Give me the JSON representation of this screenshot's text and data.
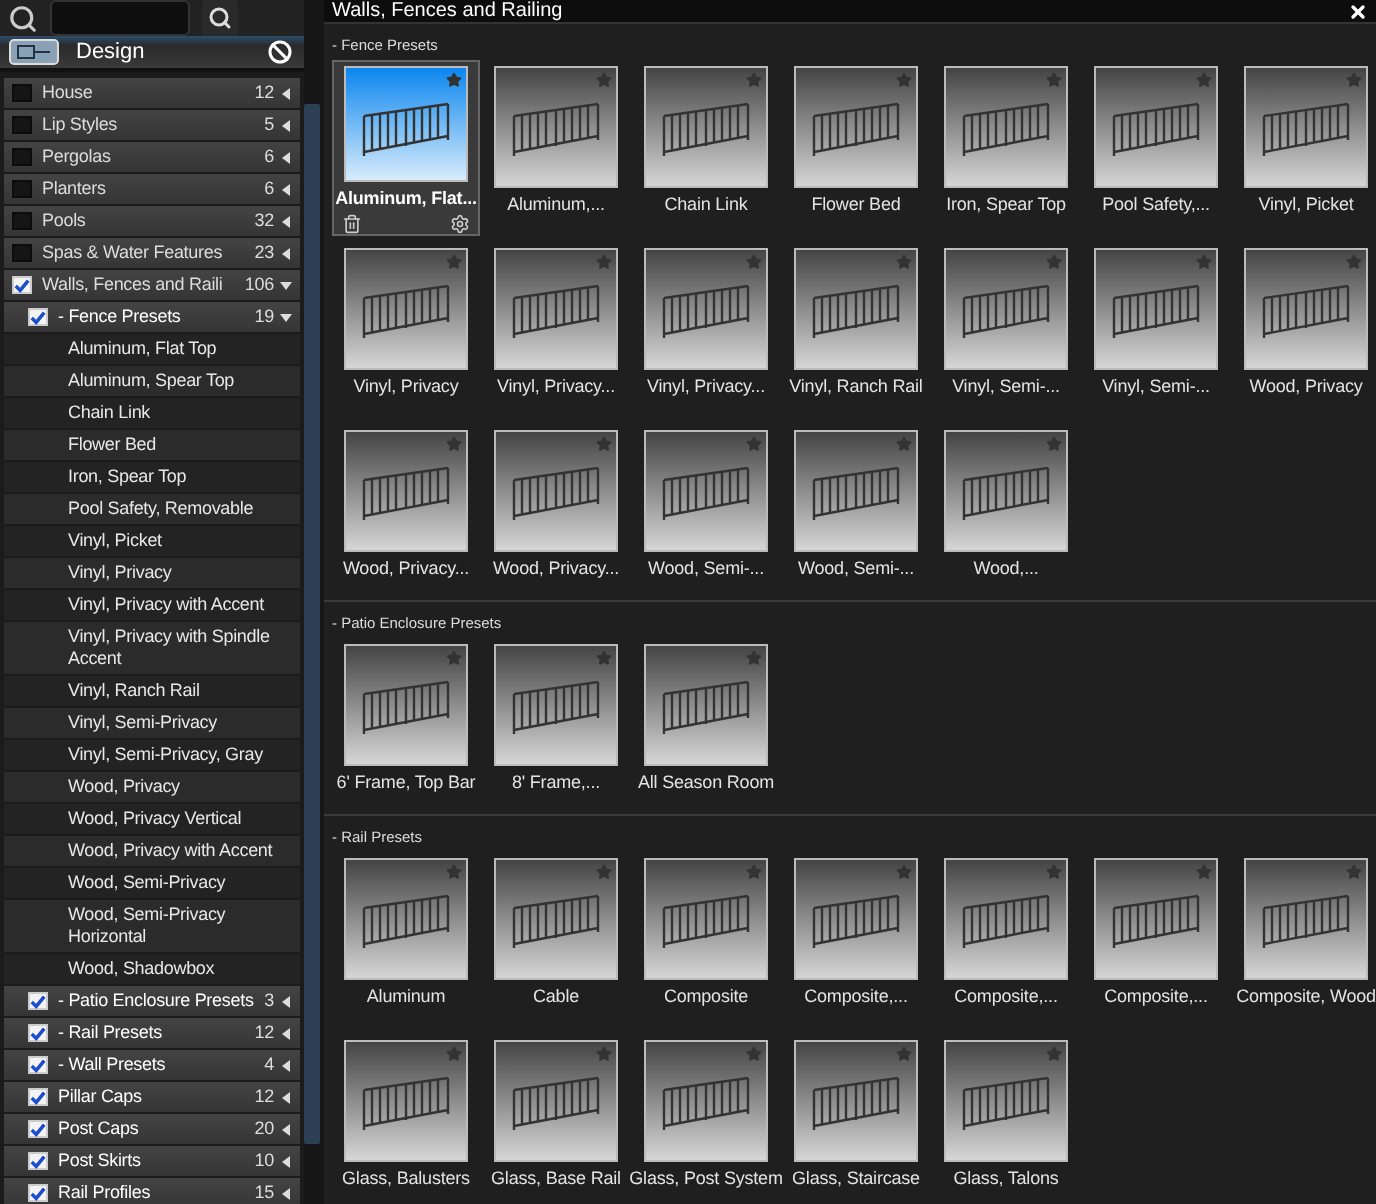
{
  "sidebar": {
    "header": {
      "title": "Design"
    },
    "categories": [
      {
        "label": "House",
        "count": "12",
        "checked": false,
        "expanded": false
      },
      {
        "label": "Lip Styles",
        "count": "5",
        "checked": false,
        "expanded": false
      },
      {
        "label": "Pergolas",
        "count": "6",
        "checked": false,
        "expanded": false
      },
      {
        "label": "Planters",
        "count": "6",
        "checked": false,
        "expanded": false
      },
      {
        "label": "Pools",
        "count": "32",
        "checked": false,
        "expanded": false
      },
      {
        "label": "Spas & Water Features",
        "count": "23",
        "checked": false,
        "expanded": false
      },
      {
        "label": "Walls, Fences and Raili",
        "count": "106",
        "checked": true,
        "expanded": true,
        "children": [
          {
            "label": "- Fence Presets",
            "count": "19",
            "checked": true,
            "expanded": true,
            "children": [
              {
                "label": "Aluminum, Flat Top"
              },
              {
                "label": "Aluminum, Spear Top"
              },
              {
                "label": "Chain Link"
              },
              {
                "label": "Flower Bed"
              },
              {
                "label": "Iron, Spear Top"
              },
              {
                "label": "Pool Safety, Removable"
              },
              {
                "label": "Vinyl, Picket"
              },
              {
                "label": "Vinyl, Privacy"
              },
              {
                "label": "Vinyl, Privacy with Accent"
              },
              {
                "label": "Vinyl, Privacy with Spindle Accent"
              },
              {
                "label": "Vinyl, Ranch Rail"
              },
              {
                "label": "Vinyl, Semi-Privacy"
              },
              {
                "label": "Vinyl, Semi-Privacy, Gray"
              },
              {
                "label": "Wood, Privacy"
              },
              {
                "label": "Wood, Privacy Vertical"
              },
              {
                "label": "Wood, Privacy with Accent"
              },
              {
                "label": "Wood, Semi-Privacy"
              },
              {
                "label": "Wood, Semi-Privacy Horizontal"
              },
              {
                "label": "Wood, Shadowbox"
              }
            ]
          },
          {
            "label": "- Patio Enclosure Presets",
            "count": "3",
            "checked": true,
            "expanded": false
          },
          {
            "label": "- Rail Presets",
            "count": "12",
            "checked": true,
            "expanded": false
          },
          {
            "label": "- Wall Presets",
            "count": "4",
            "checked": true,
            "expanded": false
          },
          {
            "label": "Pillar Caps",
            "count": "12",
            "checked": true,
            "expanded": false
          },
          {
            "label": "Post Caps",
            "count": "20",
            "checked": true,
            "expanded": false
          },
          {
            "label": "Post Skirts",
            "count": "10",
            "checked": true,
            "expanded": false
          },
          {
            "label": "Rail Profiles",
            "count": "15",
            "checked": true,
            "expanded": false
          }
        ]
      }
    ]
  },
  "main": {
    "title": "Walls, Fences and Railing",
    "sections": [
      {
        "title": "- Fence Presets",
        "items": [
          {
            "label": "Aluminum, Flat...",
            "selected": true
          },
          {
            "label": "Aluminum,...",
            "selected": false
          },
          {
            "label": "Chain Link",
            "selected": false
          },
          {
            "label": "Flower Bed",
            "selected": false
          },
          {
            "label": "Iron, Spear Top",
            "selected": false
          },
          {
            "label": "Pool Safety,...",
            "selected": false
          },
          {
            "label": "Vinyl, Picket",
            "selected": false
          },
          {
            "label": "Vinyl, Privacy",
            "selected": false
          },
          {
            "label": "Vinyl, Privacy...",
            "selected": false
          },
          {
            "label": "Vinyl, Privacy...",
            "selected": false
          },
          {
            "label": "Vinyl, Ranch Rail",
            "selected": false
          },
          {
            "label": "Vinyl, Semi-...",
            "selected": false
          },
          {
            "label": "Vinyl, Semi-...",
            "selected": false
          },
          {
            "label": "Wood, Privacy",
            "selected": false
          },
          {
            "label": "Wood, Privacy...",
            "selected": false
          },
          {
            "label": "Wood, Privacy...",
            "selected": false
          },
          {
            "label": "Wood, Semi-...",
            "selected": false
          },
          {
            "label": "Wood, Semi-...",
            "selected": false
          },
          {
            "label": "Wood,...",
            "selected": false
          }
        ]
      },
      {
        "title": "- Patio Enclosure Presets",
        "items": [
          {
            "label": "6' Frame, Top Bar",
            "selected": false
          },
          {
            "label": "8' Frame,...",
            "selected": false
          },
          {
            "label": "All Season Room",
            "selected": false
          }
        ]
      },
      {
        "title": "- Rail Presets",
        "items": [
          {
            "label": "Aluminum",
            "selected": false
          },
          {
            "label": "Cable",
            "selected": false
          },
          {
            "label": "Composite",
            "selected": false
          },
          {
            "label": "Composite,...",
            "selected": false
          },
          {
            "label": "Composite,...",
            "selected": false
          },
          {
            "label": "Composite,...",
            "selected": false
          },
          {
            "label": "Composite, Wood",
            "selected": false
          },
          {
            "label": "Glass, Balusters",
            "selected": false
          },
          {
            "label": "Glass, Base Rail",
            "selected": false
          },
          {
            "label": "Glass, Post System",
            "selected": false
          },
          {
            "label": "Glass, Staircase",
            "selected": false
          },
          {
            "label": "Glass, Talons",
            "selected": false
          }
        ]
      }
    ]
  }
}
